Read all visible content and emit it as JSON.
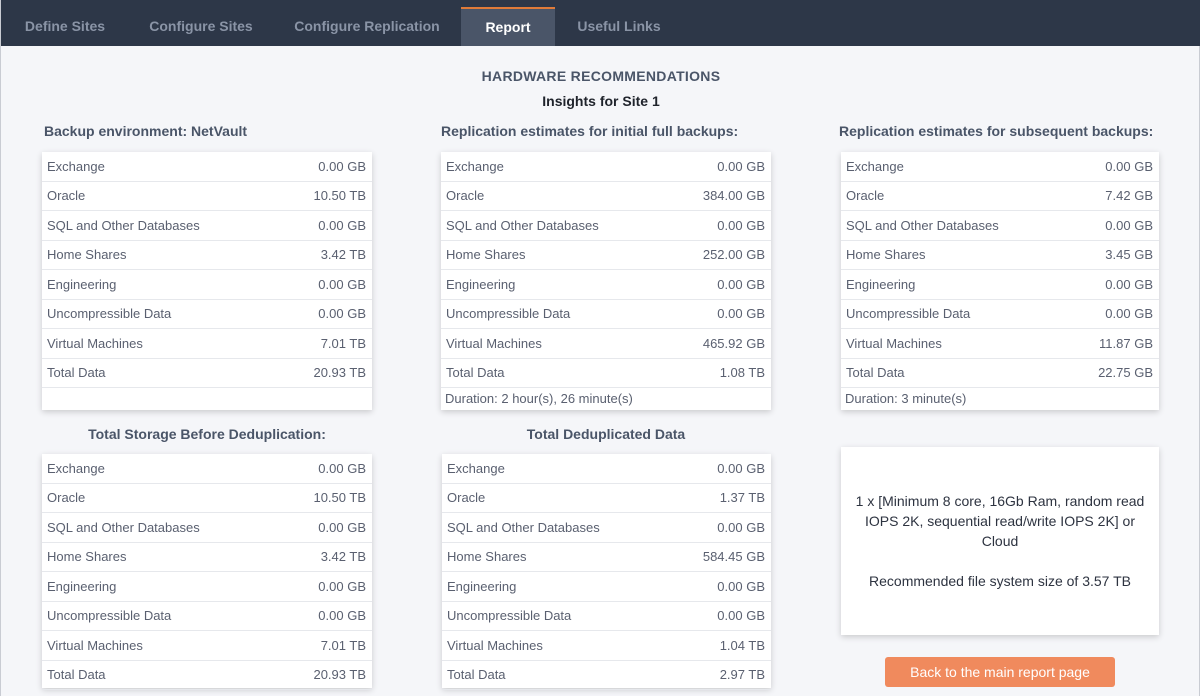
{
  "tabs": [
    {
      "label": "Define Sites",
      "active": false
    },
    {
      "label": "Configure Sites",
      "active": false
    },
    {
      "label": "Configure Replication",
      "active": false
    },
    {
      "label": "Report",
      "active": true
    },
    {
      "label": "Useful Links",
      "active": false
    }
  ],
  "page_title": "HARDWARE RECOMMENDATIONS",
  "site_title": "Insights for Site 1",
  "sections": [
    {
      "heading": "Backup environment: NetVault",
      "rows": [
        {
          "label": "Exchange",
          "value": "0.00 GB"
        },
        {
          "label": "Oracle",
          "value": "10.50 TB"
        },
        {
          "label": "SQL and Other Databases",
          "value": "0.00 GB"
        },
        {
          "label": "Home Shares",
          "value": "3.42 TB"
        },
        {
          "label": "Engineering",
          "value": "0.00 GB"
        },
        {
          "label": "Uncompressible Data",
          "value": "0.00 GB"
        },
        {
          "label": "Virtual Machines",
          "value": "7.01 TB"
        },
        {
          "label": "Total Data",
          "value": "20.93 TB"
        }
      ],
      "duration": ""
    },
    {
      "heading": "Replication estimates for initial full backups:",
      "rows": [
        {
          "label": "Exchange",
          "value": "0.00 GB"
        },
        {
          "label": "Oracle",
          "value": "384.00 GB"
        },
        {
          "label": "SQL and Other Databases",
          "value": "0.00 GB"
        },
        {
          "label": "Home Shares",
          "value": "252.00 GB"
        },
        {
          "label": "Engineering",
          "value": "0.00 GB"
        },
        {
          "label": "Uncompressible Data",
          "value": "0.00 GB"
        },
        {
          "label": "Virtual Machines",
          "value": "465.92 GB"
        },
        {
          "label": "Total Data",
          "value": "1.08 TB"
        }
      ],
      "duration": "Duration: 2 hour(s), 26 minute(s)"
    },
    {
      "heading": "Replication estimates for subsequent backups:",
      "rows": [
        {
          "label": "Exchange",
          "value": "0.00 GB"
        },
        {
          "label": "Oracle",
          "value": "7.42 GB"
        },
        {
          "label": "SQL and Other Databases",
          "value": "0.00 GB"
        },
        {
          "label": "Home Shares",
          "value": "3.45 GB"
        },
        {
          "label": "Engineering",
          "value": "0.00 GB"
        },
        {
          "label": "Uncompressible Data",
          "value": "0.00 GB"
        },
        {
          "label": "Virtual Machines",
          "value": "11.87 GB"
        },
        {
          "label": "Total Data",
          "value": "22.75 GB"
        }
      ],
      "duration": "Duration: 3 minute(s)"
    },
    {
      "heading": "Total Storage Before Deduplication:",
      "rows": [
        {
          "label": "Exchange",
          "value": "0.00 GB"
        },
        {
          "label": "Oracle",
          "value": "10.50 TB"
        },
        {
          "label": "SQL and Other Databases",
          "value": "0.00 GB"
        },
        {
          "label": "Home Shares",
          "value": "3.42 TB"
        },
        {
          "label": "Engineering",
          "value": "0.00 GB"
        },
        {
          "label": "Uncompressible Data",
          "value": "0.00 GB"
        },
        {
          "label": "Virtual Machines",
          "value": "7.01 TB"
        },
        {
          "label": "Total Data",
          "value": "20.93 TB"
        }
      ],
      "duration": ""
    },
    {
      "heading": "Total Deduplicated Data",
      "rows": [
        {
          "label": "Exchange",
          "value": "0.00 GB"
        },
        {
          "label": "Oracle",
          "value": "1.37 TB"
        },
        {
          "label": "SQL and Other Databases",
          "value": "0.00 GB"
        },
        {
          "label": "Home Shares",
          "value": "584.45 GB"
        },
        {
          "label": "Engineering",
          "value": "0.00 GB"
        },
        {
          "label": "Uncompressible Data",
          "value": "0.00 GB"
        },
        {
          "label": "Virtual Machines",
          "value": "1.04 TB"
        },
        {
          "label": "Total Data",
          "value": "2.97 TB"
        }
      ],
      "duration": ""
    }
  ],
  "recommendation": {
    "hardware": "1 x [Minimum 8 core, 16Gb Ram, random read IOPS 2K, sequential read/write IOPS 2K] or Cloud",
    "filesystem": "Recommended file system size of 3.57 TB"
  },
  "back_button_label": "Back to the main report page",
  "colors": {
    "nav_bg": "#2d3748",
    "active_tab_bg": "#4a5568",
    "accent": "#f08a5d"
  }
}
